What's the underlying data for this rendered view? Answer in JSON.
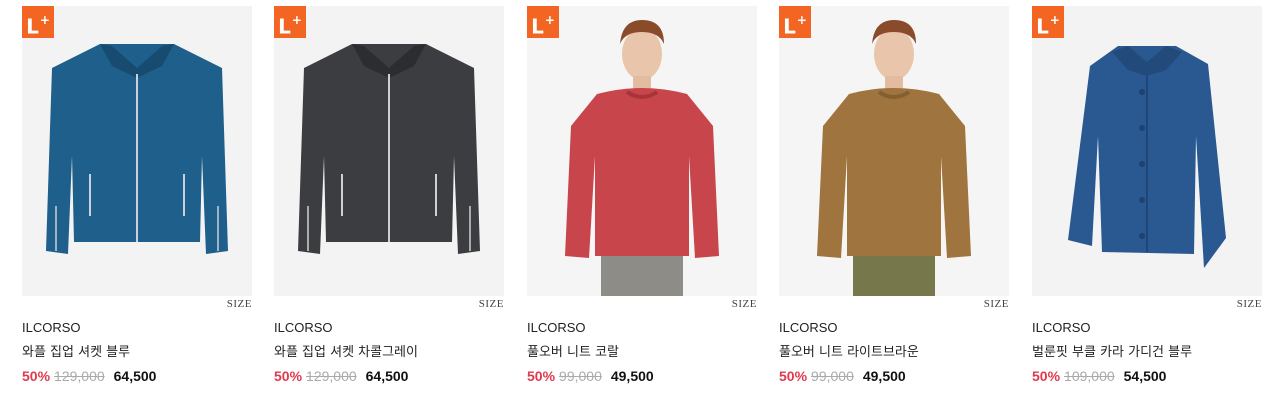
{
  "badge": {
    "label": "L",
    "sup": "+"
  },
  "size_label": "SIZE",
  "products": [
    {
      "brand": "ILCORSO",
      "name": "와플 집업 셔켓 블루",
      "discount": "50%",
      "original_price": "129,000",
      "sale_price": "64,500",
      "color": "#1f5f8b"
    },
    {
      "brand": "ILCORSO",
      "name": "와플 집업 셔켓 차콜그레이",
      "discount": "50%",
      "original_price": "129,000",
      "sale_price": "64,500",
      "color": "#3c3d40"
    },
    {
      "brand": "ILCORSO",
      "name": "풀오버 니트 코랄",
      "discount": "50%",
      "original_price": "99,000",
      "sale_price": "49,500",
      "color": "#c8464b"
    },
    {
      "brand": "ILCORSO",
      "name": "풀오버 니트 라이트브라운",
      "discount": "50%",
      "original_price": "99,000",
      "sale_price": "49,500",
      "color": "#a0743f"
    },
    {
      "brand": "ILCORSO",
      "name": "벌룬핏 부클 카라 가디건 블루",
      "discount": "50%",
      "original_price": "109,000",
      "sale_price": "54,500",
      "color": "#2a5891"
    }
  ]
}
